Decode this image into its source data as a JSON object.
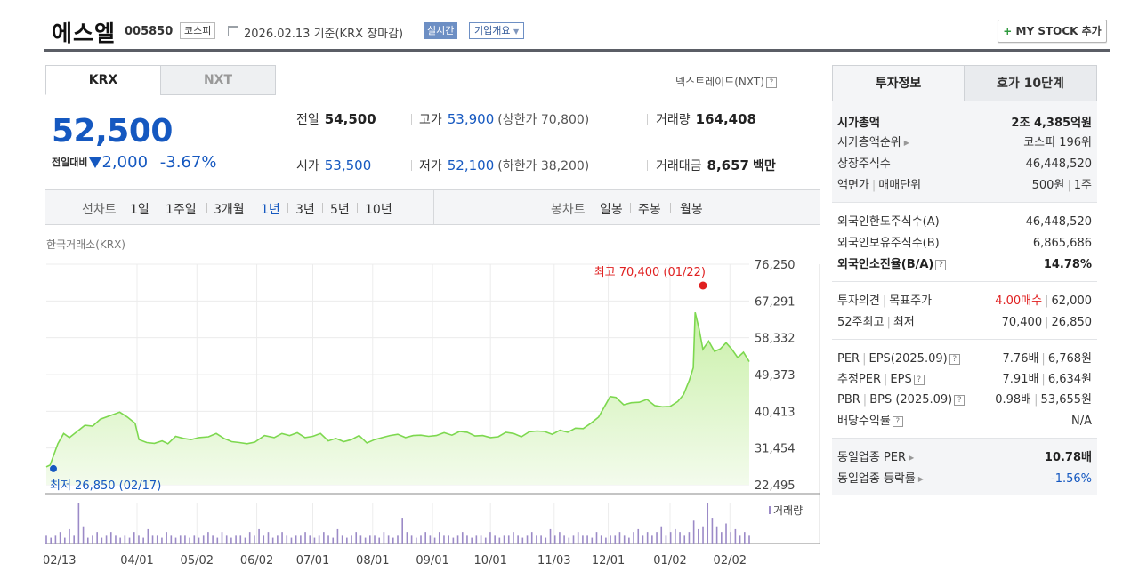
{
  "header": {
    "title": "에스엘",
    "code": "005850",
    "market": "코스피",
    "date": "2026.02.13  기준(KRX 장마감)",
    "live": "실시간",
    "overview": "기업개요",
    "mystock_plus": "+",
    "mystock_label": "MY STOCK 추가"
  },
  "tabs": {
    "krx": "KRX",
    "nxt": "NXT"
  },
  "nxt_link": "넥스트레이드(NXT)",
  "price": {
    "current": "52,500",
    "change_label": "전일대비",
    "change": "2,000",
    "change_rate": "-3.67%"
  },
  "stats": {
    "prev_close_label": "전일",
    "prev_close": "54,500",
    "open_label": "시가",
    "open": "53,500",
    "high_label": "고가",
    "high": "53,900",
    "upper_limit": "(상한가 70,800)",
    "low_label": "저가",
    "low": "52,100",
    "lower_limit": "(하한가 38,200)",
    "volume_label": "거래량",
    "volume": "164,408",
    "amount_label": "거래대금",
    "amount": "8,657",
    "amount_unit": "백만"
  },
  "period_bar": {
    "line_label": "선차트",
    "line_periods": [
      "1일",
      "1주일",
      "3개월",
      "1년",
      "3년",
      "5년",
      "10년"
    ],
    "selected_period": "1년",
    "candle_label": "봉차트",
    "candle_periods": [
      "일봉",
      "주봉",
      "월봉"
    ]
  },
  "chart_source": "한국거래소(KRX)",
  "chart_data": {
    "type": "area",
    "y_ticks": [
      "76,250",
      "67,291",
      "58,332",
      "49,373",
      "40,413",
      "31,454",
      "22,495"
    ],
    "ylim": [
      22495,
      76250
    ],
    "x_ticks": [
      "02/13",
      "04/01",
      "05/02",
      "06/02",
      "07/01",
      "08/01",
      "09/01",
      "10/01",
      "11/03",
      "12/01",
      "01/02",
      "02/02"
    ],
    "x_tick_days": [
      0,
      47,
      78,
      109,
      138,
      169,
      200,
      230,
      263,
      291,
      323,
      354
    ],
    "series": [
      {
        "name": "",
        "points": [
          [
            0,
            26850
          ],
          [
            2,
            27300
          ],
          [
            6,
            32500
          ],
          [
            9,
            35000
          ],
          [
            12,
            34000
          ],
          [
            16,
            35500
          ],
          [
            20,
            37000
          ],
          [
            24,
            36800
          ],
          [
            28,
            38500
          ],
          [
            34,
            39500
          ],
          [
            38,
            40200
          ],
          [
            42,
            39000
          ],
          [
            46,
            37500
          ],
          [
            48,
            33500
          ],
          [
            52,
            32800
          ],
          [
            56,
            32600
          ],
          [
            60,
            33200
          ],
          [
            63,
            32500
          ],
          [
            67,
            34300
          ],
          [
            71,
            33800
          ],
          [
            75,
            33500
          ],
          [
            79,
            34000
          ],
          [
            84,
            34200
          ],
          [
            88,
            35000
          ],
          [
            92,
            33800
          ],
          [
            96,
            33000
          ],
          [
            100,
            32800
          ],
          [
            104,
            32500
          ],
          [
            108,
            32900
          ],
          [
            113,
            34500
          ],
          [
            118,
            34000
          ],
          [
            122,
            35000
          ],
          [
            126,
            34500
          ],
          [
            130,
            35200
          ],
          [
            134,
            34000
          ],
          [
            138,
            34300
          ],
          [
            142,
            35000
          ],
          [
            146,
            33200
          ],
          [
            150,
            33800
          ],
          [
            154,
            33000
          ],
          [
            158,
            33500
          ],
          [
            162,
            34500
          ],
          [
            166,
            32700
          ],
          [
            170,
            33500
          ],
          [
            174,
            34000
          ],
          [
            178,
            34500
          ],
          [
            182,
            34800
          ],
          [
            186,
            34000
          ],
          [
            190,
            34500
          ],
          [
            194,
            34600
          ],
          [
            198,
            34300
          ],
          [
            202,
            34500
          ],
          [
            206,
            35200
          ],
          [
            210,
            34600
          ],
          [
            214,
            35500
          ],
          [
            218,
            35300
          ],
          [
            222,
            34400
          ],
          [
            226,
            34500
          ],
          [
            230,
            34000
          ],
          [
            234,
            34200
          ],
          [
            238,
            35300
          ],
          [
            242,
            35000
          ],
          [
            246,
            34200
          ],
          [
            250,
            35400
          ],
          [
            254,
            35600
          ],
          [
            258,
            35500
          ],
          [
            262,
            34800
          ],
          [
            266,
            35800
          ],
          [
            270,
            35300
          ],
          [
            274,
            36300
          ],
          [
            278,
            36200
          ],
          [
            282,
            37500
          ],
          [
            286,
            39000
          ],
          [
            289,
            41500
          ],
          [
            292,
            44000
          ],
          [
            295,
            43800
          ],
          [
            299,
            42000
          ],
          [
            303,
            42500
          ],
          [
            307,
            42600
          ],
          [
            311,
            43300
          ],
          [
            315,
            41800
          ],
          [
            319,
            41500
          ],
          [
            323,
            41600
          ],
          [
            327,
            42800
          ],
          [
            330,
            44500
          ],
          [
            333,
            48000
          ],
          [
            335,
            51000
          ],
          [
            336,
            64500
          ],
          [
            338,
            60500
          ],
          [
            340,
            55500
          ],
          [
            343,
            57500
          ],
          [
            346,
            55000
          ],
          [
            349,
            55600
          ],
          [
            352,
            57100
          ],
          [
            355,
            55500
          ],
          [
            358,
            53500
          ],
          [
            361,
            54800
          ],
          [
            364,
            52500
          ]
        ]
      }
    ],
    "high_label": "최고 70,400 (01/22)",
    "high_point": [
      336,
      70400
    ],
    "low_label": "최저 26,850 (02/17)",
    "low_point": [
      0,
      26850
    ],
    "volume_label": "거래량",
    "volume_bars": [
      3,
      2,
      3,
      4,
      2,
      5,
      3,
      14,
      6,
      2,
      3,
      4,
      2,
      3,
      4,
      3,
      2,
      3,
      2,
      4,
      3,
      2,
      5,
      3,
      3,
      2,
      4,
      3,
      2,
      3,
      3,
      2,
      3,
      2,
      3,
      4,
      3,
      2,
      4,
      3,
      2,
      3,
      3,
      2,
      4,
      3,
      5,
      3,
      4,
      2,
      3,
      4,
      3,
      2,
      3,
      3,
      4,
      3,
      2,
      3,
      4,
      3,
      2,
      5,
      3,
      2,
      3,
      4,
      3,
      2,
      3,
      3,
      2,
      4,
      3,
      2,
      3,
      9,
      4,
      3,
      2,
      3,
      4,
      3,
      2,
      4,
      3,
      3,
      2,
      3,
      4,
      3,
      2,
      3,
      3,
      2,
      4,
      3,
      2,
      3,
      3,
      4,
      3,
      2,
      3,
      4,
      3,
      3,
      2,
      5,
      3,
      4,
      3,
      2,
      3,
      4,
      3,
      3,
      2,
      4,
      3,
      2,
      3,
      3,
      4,
      3,
      2,
      4,
      5,
      3,
      4,
      3,
      4,
      6,
      3,
      4,
      5,
      4,
      3,
      4,
      8,
      5,
      6,
      14,
      9,
      6,
      4,
      7,
      4,
      5,
      3,
      4,
      3
    ],
    "grid": true
  },
  "right_tabs": {
    "info": "투자정보",
    "quote": "호가 10단계"
  },
  "right": {
    "market_cap_label": "시가총액",
    "market_cap": "2조 4,385억원",
    "cap_rank_label": "시가총액순위",
    "cap_rank": "코스피 196위",
    "shares_label": "상장주식수",
    "shares": "46,448,520",
    "par_label": "액면가",
    "unit_label": "매매단위",
    "par": "500원",
    "unit": "1주",
    "foreign_limit_label": "외국인한도주식수(A)",
    "foreign_limit": "46,448,520",
    "foreign_own_label": "외국인보유주식수(B)",
    "foreign_own": "6,865,686",
    "foreign_rate_label": "외국인소진율(B/A)",
    "foreign_rate": "14.78%",
    "opinion_label": "투자의견",
    "target_label": "목표주가",
    "opinion": "4.00매수",
    "target": "62,000",
    "w52_label": "52주최고",
    "w52_low_label": "최저",
    "w52_high": "70,400",
    "w52_low": "26,850",
    "per_label": "PER",
    "eps_label": "EPS(2025.09)",
    "per": "7.76배",
    "eps": "6,768원",
    "est_per_label": "추정PER",
    "est_eps_label": "EPS",
    "est_per": "7.91배",
    "est_eps": "6,634원",
    "pbr_label": "PBR",
    "bps_label": "BPS (2025.09)",
    "pbr": "0.98배",
    "bps": "53,655원",
    "div_label": "배당수익률",
    "div": "N/A",
    "ind_per_label": "동일업종 PER",
    "ind_per": "10.78배",
    "ind_rate_label": "동일업종 등락률",
    "ind_rate": "-1.56%"
  },
  "colors": {
    "down": "#1558c0",
    "up": "#e02020",
    "line": "#7dd84f",
    "volume": "#9b8ac7"
  }
}
